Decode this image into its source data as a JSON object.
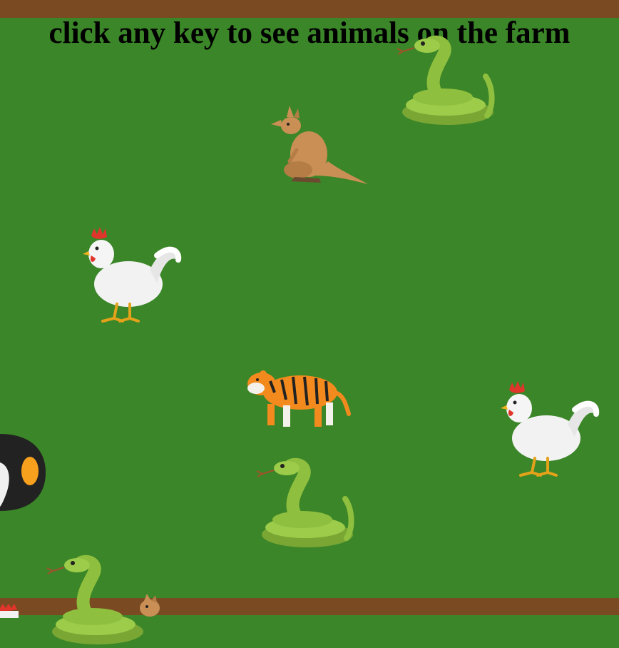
{
  "header": {
    "title": "click any key to see animals on the farm"
  },
  "colors": {
    "field": "#3b8628",
    "border": "#7a4a22",
    "snake": "#8fbf3f",
    "tiger": "#f28a1e",
    "kangaroo": "#c98f55",
    "rooster": "#f2f2f2",
    "comb": "#e0352b"
  },
  "animals": [
    {
      "name": "snake-icon"
    },
    {
      "name": "kangaroo-icon"
    },
    {
      "name": "rooster-icon"
    },
    {
      "name": "tiger-icon"
    },
    {
      "name": "rooster-icon"
    },
    {
      "name": "penguin-icon"
    },
    {
      "name": "snake-icon"
    },
    {
      "name": "snake-icon"
    },
    {
      "name": "kangaroo-icon"
    },
    {
      "name": "rooster-icon"
    }
  ]
}
